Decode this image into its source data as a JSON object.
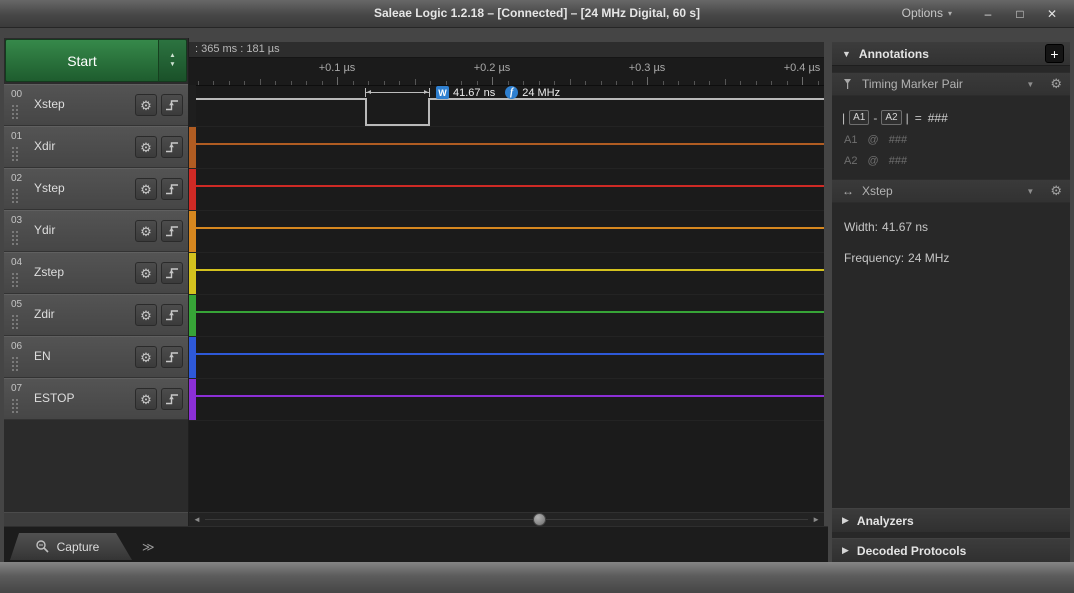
{
  "window": {
    "title": "Saleae Logic 1.2.18 – [Connected] – [24 MHz Digital, 60 s]",
    "options_label": "Options"
  },
  "icons": {
    "minimize": "–",
    "maximize": "□",
    "close": "✕",
    "options_caret": "▾",
    "collapse_open": "▼",
    "collapse_closed": "▶",
    "dropdown": "▼",
    "gear": "⚙",
    "plus": "+",
    "arrow_up": "▲",
    "arrow_down": "▼",
    "scroll_left": "◄",
    "scroll_right": "►",
    "more_chevrons": "≫",
    "double_arrow": "↔",
    "formula_pipe": "|",
    "formula_minus": "-",
    "formula_equals": "="
  },
  "left_panel": {
    "start_button": "Start",
    "channels": [
      {
        "num": "00",
        "name": "Xstep",
        "stripe_color": "#1e1e1e",
        "trace_color": "#b9b9b9",
        "waveform": "high-with-low-pulse"
      },
      {
        "num": "01",
        "name": "Xdir",
        "stripe_color": "#b05c22",
        "trace_color": "#b05c22",
        "waveform": "high"
      },
      {
        "num": "02",
        "name": "Ystep",
        "stripe_color": "#cf2a25",
        "trace_color": "#cf2a25",
        "waveform": "high"
      },
      {
        "num": "03",
        "name": "Ydir",
        "stripe_color": "#d6871f",
        "trace_color": "#d6871f",
        "waveform": "high"
      },
      {
        "num": "04",
        "name": "Zstep",
        "stripe_color": "#d4c21e",
        "trace_color": "#d4c21e",
        "waveform": "high"
      },
      {
        "num": "05",
        "name": "Zdir",
        "stripe_color": "#37a437",
        "trace_color": "#37a437",
        "waveform": "high"
      },
      {
        "num": "06",
        "name": "EN",
        "stripe_color": "#2e59d8",
        "trace_color": "#2e59d8",
        "waveform": "high"
      },
      {
        "num": "07",
        "name": "ESTOP",
        "stripe_color": "#8c2fd6",
        "trace_color": "#8c2fd6",
        "waveform": "high"
      }
    ]
  },
  "timeline": {
    "position_text": ": 365 ms : 181 µs",
    "tick_labels": [
      "+0.1 µs",
      "+0.2 µs",
      "+0.3 µs",
      "+0.4 µs"
    ]
  },
  "measurement_overlay": {
    "width_badge": "W",
    "width_value": "41.67 ns",
    "freq_badge": "f",
    "freq_value": "24 MHz"
  },
  "right_panel": {
    "annotations_header": "Annotations",
    "timing_marker_pair": {
      "title": "Timing Marker Pair",
      "a1_label": "A1",
      "a2_label": "A2",
      "result_value": "###",
      "a1_row": {
        "label": "A1",
        "at": "@",
        "value": "###"
      },
      "a2_row": {
        "label": "A2",
        "at": "@",
        "value": "###"
      }
    },
    "measurement_section": {
      "title": "Xstep",
      "width_label": "Width:",
      "width_value": "41.67 ns",
      "frequency_label": "Frequency:",
      "frequency_value": "24 MHz"
    },
    "analyzers_header": "Analyzers",
    "decoded_protocols_header": "Decoded Protocols"
  },
  "bottom_bar": {
    "capture_tab": "Capture"
  }
}
